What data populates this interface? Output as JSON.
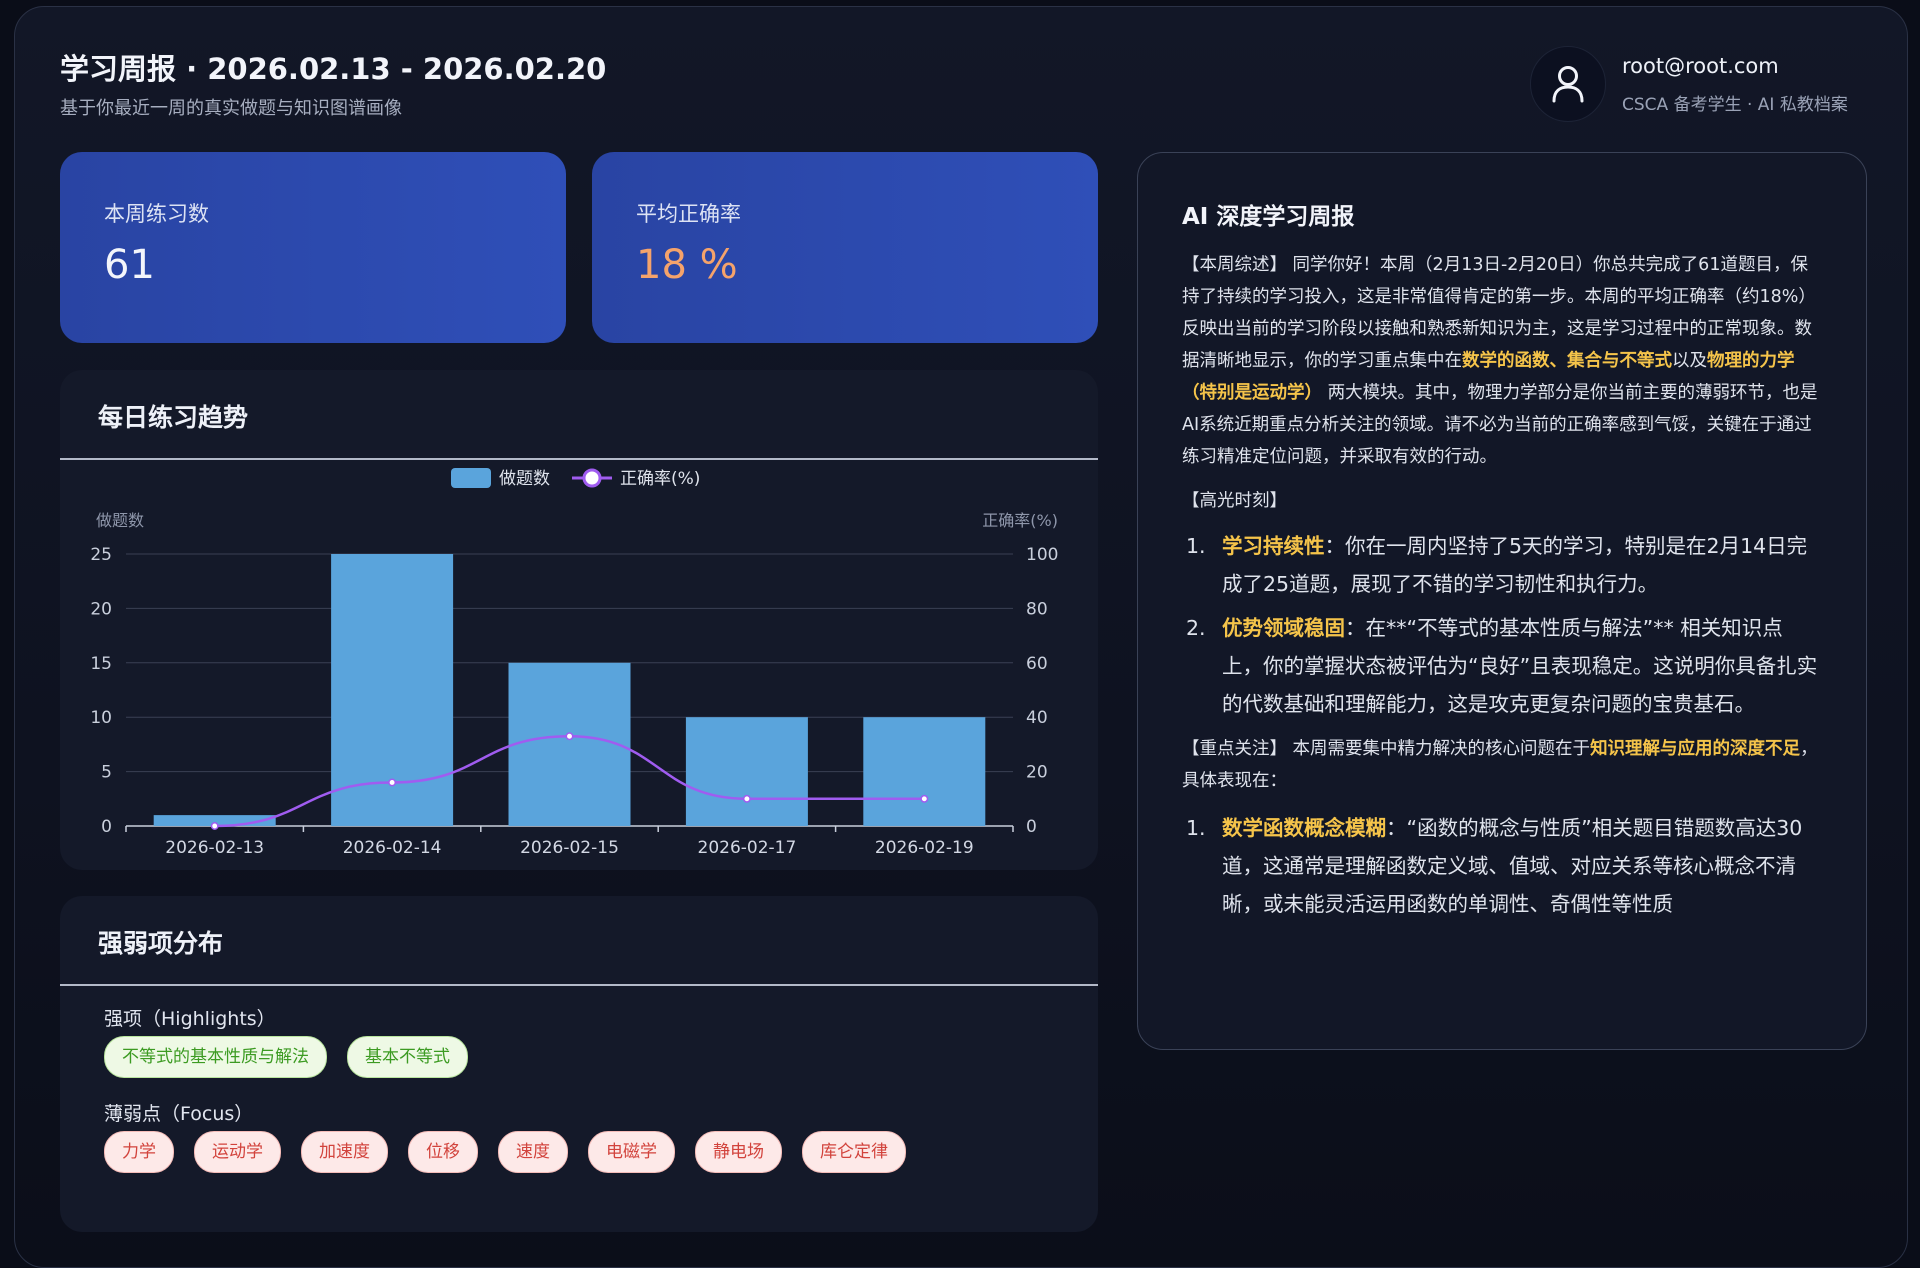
{
  "header": {
    "title": "学习周报 · 2026.02.13 - 2026.02.20",
    "subtitle": "基于你最近一周的真实做题与知识图谱画像"
  },
  "user": {
    "email": "root@root.com",
    "role": "CSCA 备考学生 · AI 私教档案",
    "icon": "user-icon"
  },
  "stats": {
    "practice_label": "本周练习数",
    "practice_value": "61",
    "accuracy_label": "平均正确率",
    "accuracy_value": "18 %"
  },
  "trend": {
    "title": "每日练习趋势"
  },
  "chart_data": {
    "type": "bar",
    "categories": [
      "2026-02-13",
      "2026-02-14",
      "2026-02-15",
      "2026-02-17",
      "2026-02-19"
    ],
    "series": [
      {
        "name": "做题数",
        "type": "bar",
        "axis": "left",
        "color": "#5aa4dc",
        "values": [
          1,
          25,
          15,
          10,
          10
        ]
      },
      {
        "name": "正确率(%)",
        "type": "line",
        "axis": "right",
        "color": "#a05cf0",
        "values": [
          0,
          16,
          33,
          10,
          10
        ]
      }
    ],
    "ylabel_left": "做题数",
    "ylabel_right": "正确率(%)",
    "ylim_left": [
      0,
      25
    ],
    "ylim_right": [
      0,
      100
    ],
    "yticks_left": [
      "0",
      "5",
      "10",
      "15",
      "20",
      "25"
    ],
    "yticks_right": [
      "0",
      "20",
      "40",
      "60",
      "80",
      "100"
    ],
    "legend_position": "top-center",
    "grid": true
  },
  "strengths": {
    "title": "强弱项分布",
    "strong_label": "强项（Highlights）",
    "strong_items": [
      "不等式的基本性质与解法",
      "基本不等式"
    ],
    "weak_label": "薄弱点（Focus）",
    "weak_items": [
      "力学",
      "运动学",
      "加速度",
      "位移",
      "速度",
      "电磁学",
      "静电场",
      "库仑定律"
    ]
  },
  "report": {
    "title": "AI 深度学习周报",
    "summary": [
      {
        "t": "【本周综述】 同学你好！本周（2月13日-2月20日）你总共完成了61道题目，保持了持续的学习投入，这是非常值得肯定的第一步。本周的平均正确率（约18%）反映出当前的学习阶段以接触和熟悉新知识为主，这是学习过程中的正常现象。数据清晰地显示，你的学习重点集中在"
      },
      {
        "t": "数学的函数、集合与不等式",
        "hl": true
      },
      {
        "t": "以及"
      },
      {
        "t": "物理的力学（特别是运动学）",
        "hl": true
      },
      {
        "t": " 两大模块。其中，物理力学部分是你当前主要的薄弱环节，也是AI系统近期重点分析关注的领域。请不必为当前的正确率感到气馁，关键在于通过练习精准定位问题，并采取有效的行动。"
      }
    ],
    "highlights_label": "【高光时刻】",
    "highlights": [
      {
        "num": "1.",
        "head": "学习持续性",
        "body": "：你在一周内坚持了5天的学习，特别是在2月14日完成了25道题，展现了不错的学习韧性和执行力。"
      },
      {
        "num": "2.",
        "head": "优势领域稳固",
        "body": "：在**“不等式的基本性质与解法”** 相关知识点上，你的掌握状态被评估为“良好”且表现稳定。这说明你具备扎实的代数基础和理解能力，这是攻克更复杂问题的宝贵基石。"
      }
    ],
    "focus": [
      {
        "t": "【重点关注】 本周需要集中精力解决的核心问题在于"
      },
      {
        "t": "知识理解与应用的深度不足",
        "hl": true
      },
      {
        "t": "，具体表现在："
      }
    ],
    "focus_items": [
      {
        "num": "1.",
        "head": "数学函数概念模糊",
        "body": "：“函数的概念与性质”相关题目错题数高达30道，这通常是理解函数定义域、值域、对应关系等核心概念不清晰，或未能灵活运用函数的单调性、奇偶性等性质"
      }
    ]
  }
}
